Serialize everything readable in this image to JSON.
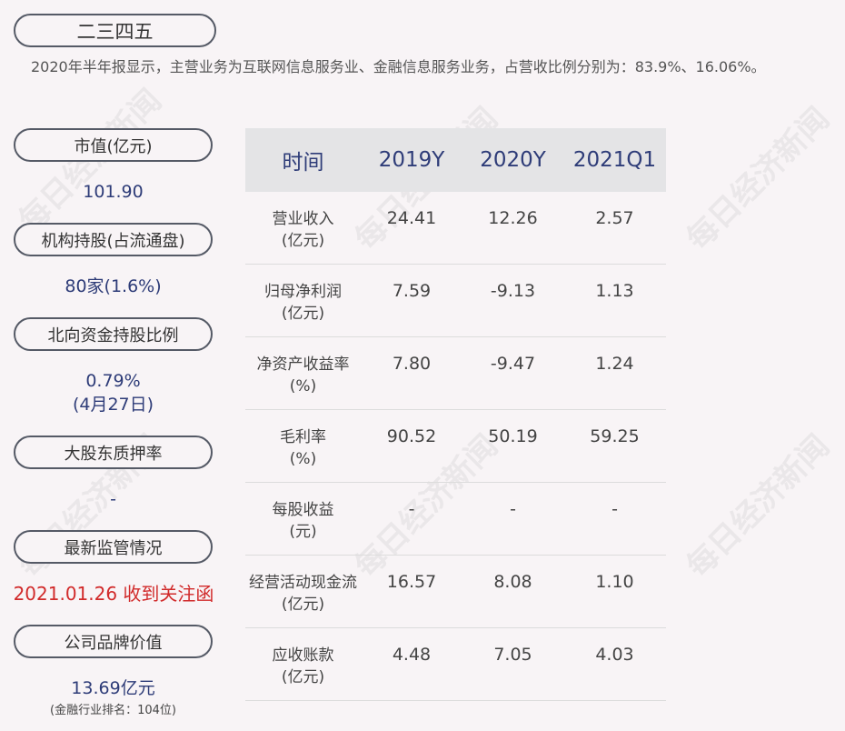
{
  "title": "二三四五",
  "description": "2020年半年报显示，主营业务为互联网信息服务业、金融信息服务业务，占营收比例分别为：83.9%、16.06%。",
  "left_panel": [
    {
      "label": "市值(亿元)",
      "value": "101.90"
    },
    {
      "label": "机构持股(占流通盘)",
      "value": "80家(1.6%)"
    },
    {
      "label": "北向资金持股比例",
      "value": "0.79%",
      "value2": "(4月27日)"
    },
    {
      "label": "大股东质押率",
      "value": "-"
    },
    {
      "label": "最新监管情况",
      "value": "2021.01.26 收到关注函"
    },
    {
      "label": "公司品牌价值",
      "value": "13.69亿元",
      "sub": "(金融行业排名：104位)"
    }
  ],
  "table": {
    "headers": [
      "时间",
      "2019Y",
      "2020Y",
      "2021Q1"
    ],
    "rows": [
      {
        "label": "营业收入",
        "unit": "(亿元)",
        "values": [
          "24.41",
          "12.26",
          "2.57"
        ]
      },
      {
        "label": "归母净利润",
        "unit": "(亿元)",
        "values": [
          "7.59",
          "-9.13",
          "1.13"
        ]
      },
      {
        "label": "净资产收益率",
        "unit": "(%)",
        "values": [
          "7.80",
          "-9.47",
          "1.24"
        ]
      },
      {
        "label": "毛利率",
        "unit": "(%)",
        "values": [
          "90.52",
          "50.19",
          "59.25"
        ]
      },
      {
        "label": "每股收益",
        "unit": "(元)",
        "values": [
          "-",
          "-",
          "-"
        ]
      },
      {
        "label": "经营活动现金流",
        "unit": "(亿元)",
        "values": [
          "16.57",
          "8.08",
          "1.10"
        ]
      },
      {
        "label": "应收账款",
        "unit": "(亿元)",
        "values": [
          "4.48",
          "7.05",
          "4.03"
        ]
      }
    ]
  },
  "watermark": "每日经济新闻",
  "colors": {
    "accent_blue": "#2e3c78",
    "alert_red": "#d12a2a",
    "header_bg": "#e4e4e6"
  }
}
